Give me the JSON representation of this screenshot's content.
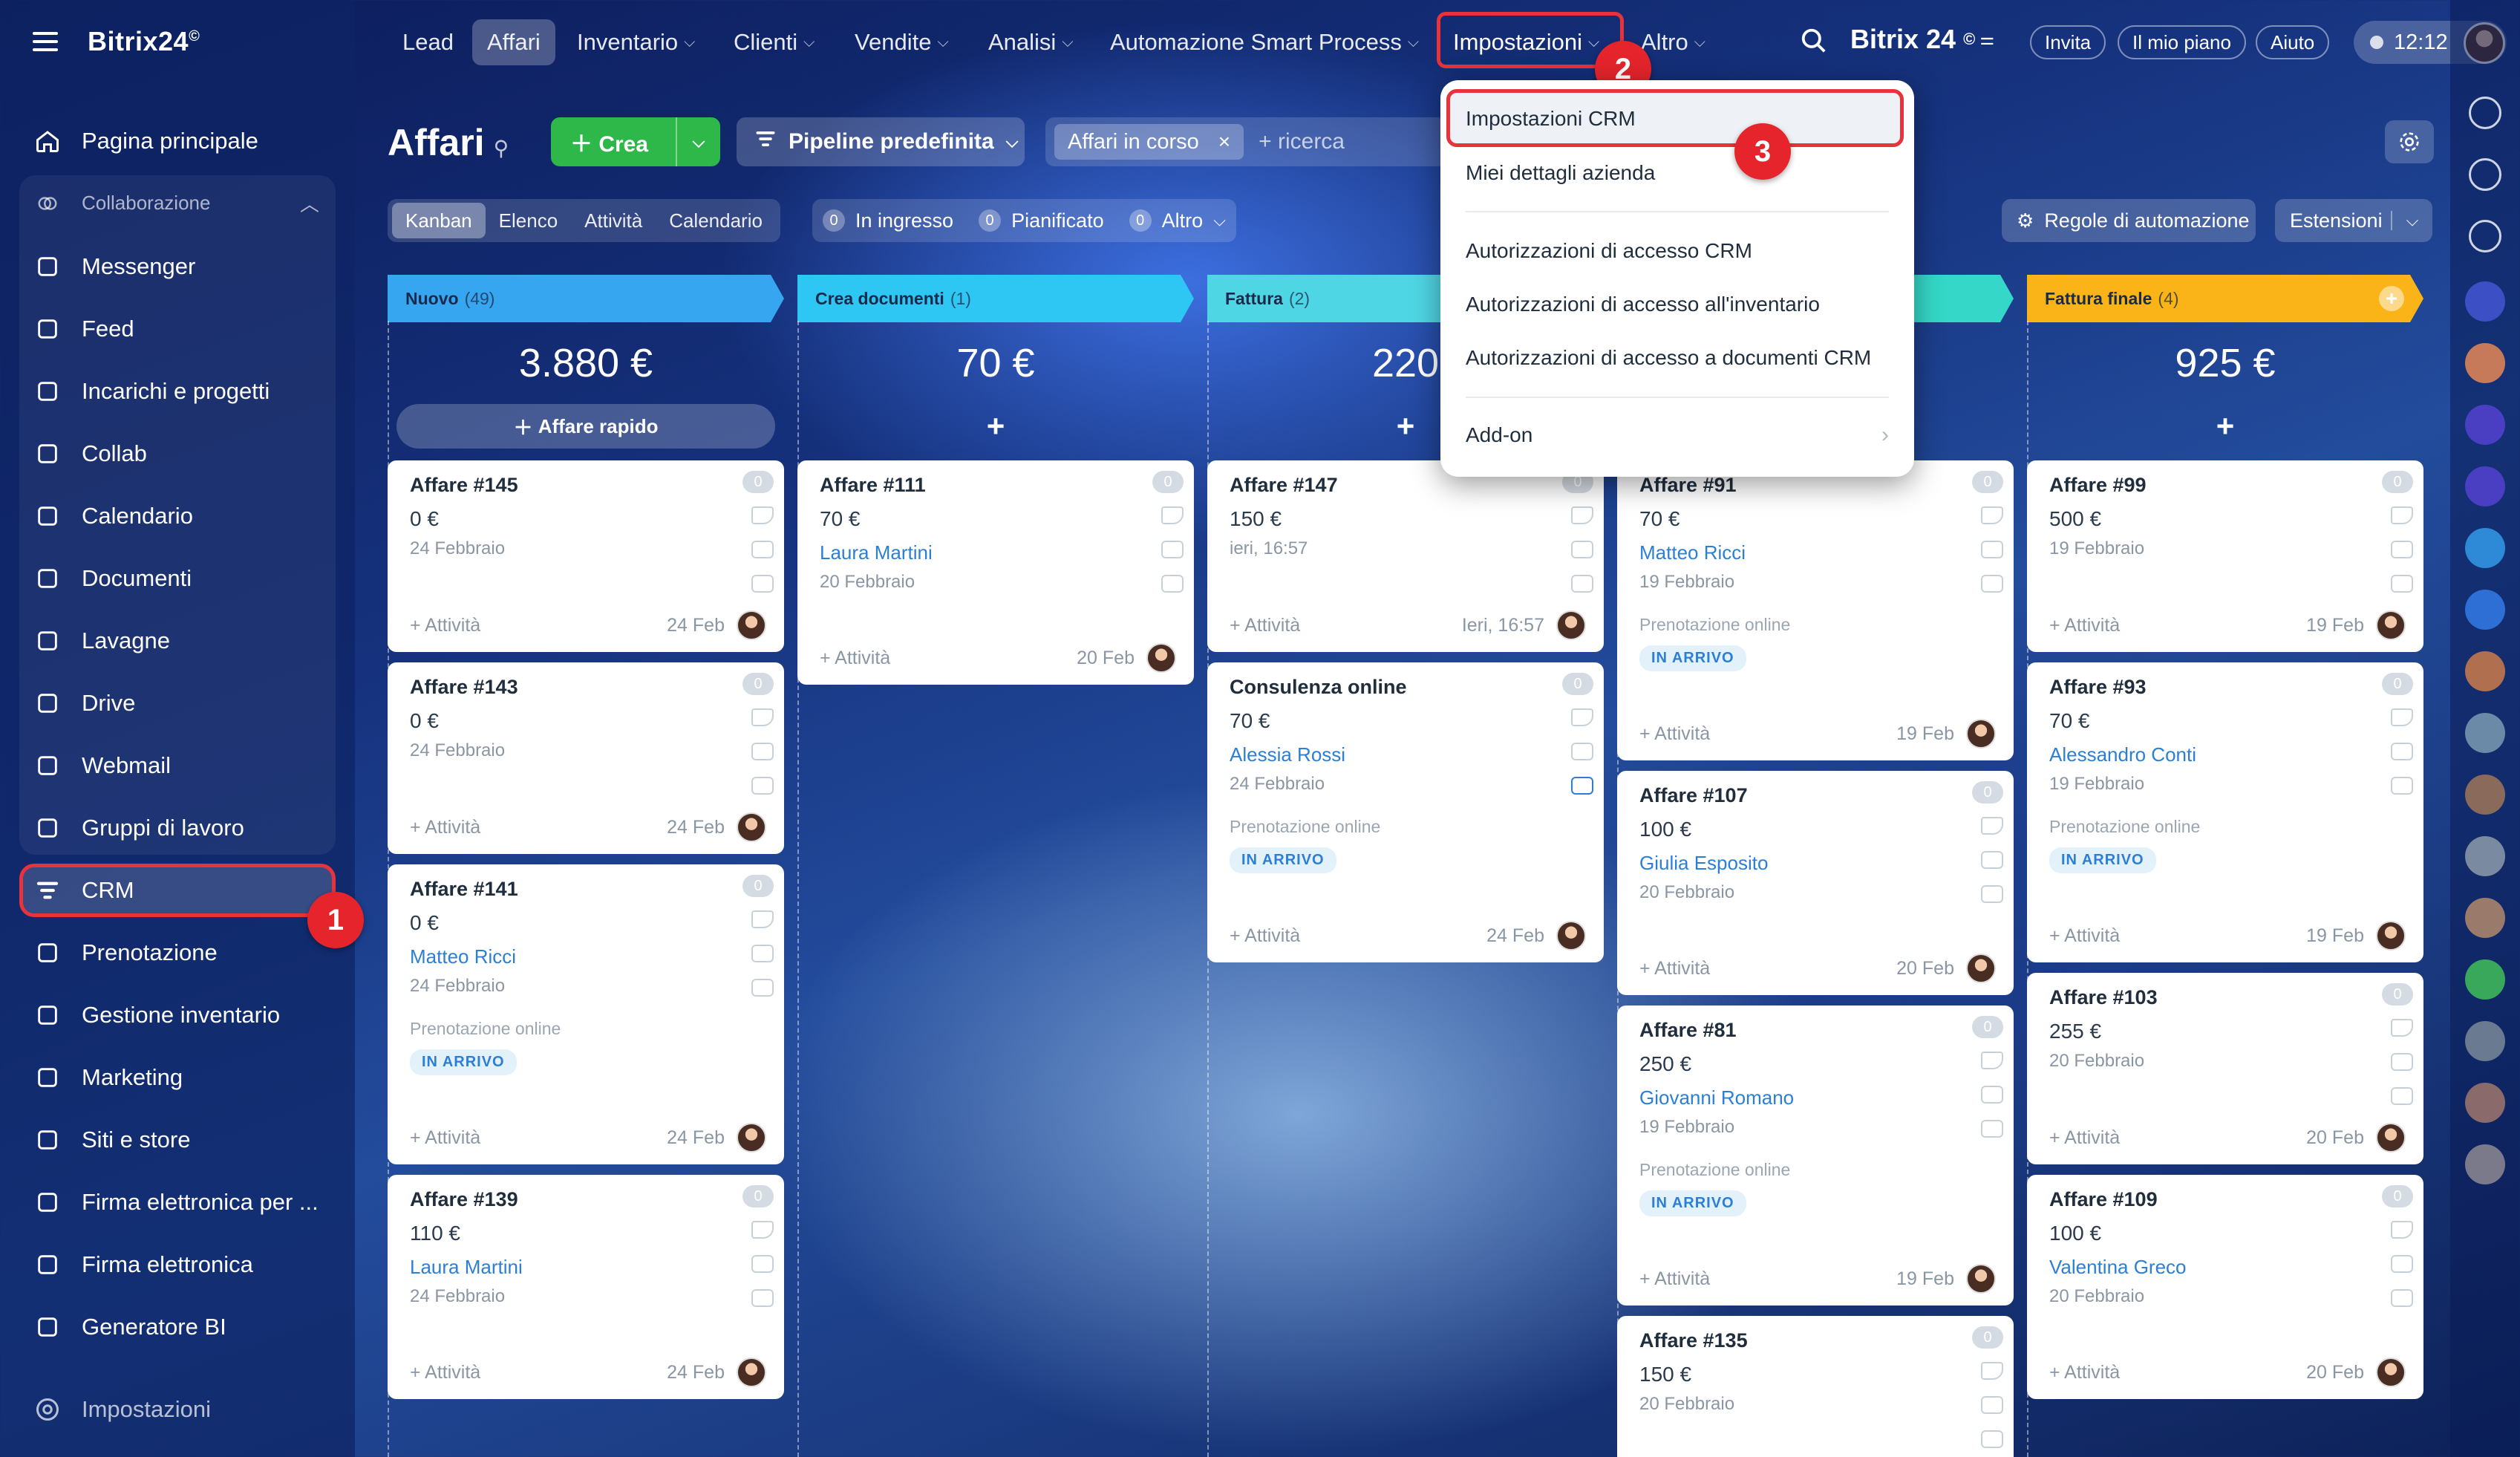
{
  "app": {
    "logo": "Bitrix24",
    "logo_mark": "©"
  },
  "sidebar": {
    "home": "Pagina principale",
    "group_label": "Collaborazione",
    "items": [
      {
        "label": "Messenger",
        "icon": "messenger-icon"
      },
      {
        "label": "Feed",
        "icon": "feed-icon"
      },
      {
        "label": "Incarichi e progetti",
        "icon": "tasks-icon"
      },
      {
        "label": "Collab",
        "icon": "collab-icon"
      },
      {
        "label": "Calendario",
        "icon": "calendar-icon"
      },
      {
        "label": "Documenti",
        "icon": "documents-icon"
      },
      {
        "label": "Lavagne",
        "icon": "boards-icon"
      },
      {
        "label": "Drive",
        "icon": "drive-icon"
      },
      {
        "label": "Webmail",
        "icon": "mail-icon"
      },
      {
        "label": "Gruppi di lavoro",
        "icon": "groups-icon"
      }
    ],
    "crm": "CRM",
    "items2": [
      {
        "label": "Prenotazione",
        "icon": "booking-icon"
      },
      {
        "label": "Gestione inventario",
        "icon": "inventory-icon"
      },
      {
        "label": "Marketing",
        "icon": "marketing-icon"
      },
      {
        "label": "Siti e store",
        "icon": "store-icon"
      },
      {
        "label": "Firma elettronica per ...",
        "icon": "esign-hr-icon"
      },
      {
        "label": "Firma elettronica",
        "icon": "esign-icon"
      },
      {
        "label": "Generatore BI",
        "icon": "bi-icon"
      }
    ],
    "settings": "Impostazioni"
  },
  "topnav": {
    "items": [
      "Lead",
      "Affari",
      "Inventario",
      "Clienti",
      "Vendite",
      "Analisi",
      "Automazione Smart Process",
      "Impostazioni",
      "Altro"
    ],
    "brand": "Bitrix 24",
    "invite": "Invita",
    "plan": "Il mio piano",
    "help": "Aiuto",
    "clock": "12:12"
  },
  "toolbar": {
    "title": "Affari",
    "create": "Crea",
    "pipeline": "Pipeline predefinita",
    "filter_chip": "Affari in corso",
    "search_placeholder": "+ ricerca",
    "views": [
      "Kanban",
      "Elenco",
      "Attività",
      "Calendario"
    ],
    "counters": [
      {
        "n": "0",
        "label": "In ingresso"
      },
      {
        "n": "0",
        "label": "Pianificato"
      },
      {
        "n": "0",
        "label": "Altro"
      }
    ],
    "rules": "Regole di automazione",
    "extensions": "Estensioni"
  },
  "kanban": {
    "quick_deal": "Affare rapido",
    "add_activity": "+ Attività",
    "columns": [
      {
        "name": "Nuovo",
        "count": "(49)",
        "total": "3.880 €",
        "color": "#37a6f0"
      },
      {
        "name": "Crea documenti",
        "count": "(1)",
        "total": "70 €",
        "color": "#2ec6f2"
      },
      {
        "name": "Fattura",
        "count": "(2)",
        "total": "220",
        "color": "#4fd6e4"
      },
      {
        "name": "",
        "count": "",
        "total": "",
        "color": "#35d8c8"
      },
      {
        "name": "Fattura finale",
        "count": "(4)",
        "total": "925 €",
        "color": "#fbb417"
      }
    ],
    "cards": [
      {
        "col": 0,
        "title": "Affare #145",
        "amount": "0 €",
        "contact": "",
        "date": "24 Febbraio",
        "source": "",
        "tag": "",
        "foot": "24 Feb",
        "badge": "0"
      },
      {
        "col": 0,
        "title": "Affare #143",
        "amount": "0 €",
        "contact": "",
        "date": "24 Febbraio",
        "source": "",
        "tag": "",
        "foot": "24 Feb",
        "badge": "0"
      },
      {
        "col": 0,
        "title": "Affare #141",
        "amount": "0 €",
        "contact": "Matteo Ricci",
        "date": "24 Febbraio",
        "source": "Prenotazione online",
        "tag": "IN ARRIVO",
        "foot": "24 Feb",
        "badge": "0"
      },
      {
        "col": 0,
        "title": "Affare #139",
        "amount": "110 €",
        "contact": "Laura Martini",
        "date": "24 Febbraio",
        "source": "",
        "tag": "",
        "foot": "24 Feb",
        "badge": "0"
      },
      {
        "col": 1,
        "title": "Affare #111",
        "amount": "70 €",
        "contact": "Laura Martini",
        "date": "20 Febbraio",
        "source": "",
        "tag": "",
        "foot": "20 Feb",
        "badge": "0"
      },
      {
        "col": 2,
        "title": "Affare #147",
        "amount": "150 €",
        "contact": "",
        "date": "ieri, 16:57",
        "source": "",
        "tag": "",
        "foot": "Ieri, 16:57",
        "badge": "0"
      },
      {
        "col": 2,
        "title": "Consulenza online",
        "amount": "70 €",
        "contact": "Alessia Rossi",
        "date": "24 Febbraio",
        "source": "Prenotazione online",
        "tag": "IN ARRIVO",
        "foot": "24 Feb",
        "badge": "0"
      },
      {
        "col": 3,
        "title": "Affare #91",
        "amount": "70 €",
        "contact": "Matteo Ricci",
        "date": "19 Febbraio",
        "source": "Prenotazione online",
        "tag": "IN ARRIVO",
        "foot": "19 Feb",
        "badge": "0"
      },
      {
        "col": 3,
        "title": "Affare #107",
        "amount": "100 €",
        "contact": "Giulia Esposito",
        "date": "20 Febbraio",
        "source": "",
        "tag": "",
        "foot": "20 Feb",
        "badge": "0"
      },
      {
        "col": 3,
        "title": "Affare #81",
        "amount": "250 €",
        "contact": "Giovanni Romano",
        "date": "19 Febbraio",
        "source": "Prenotazione online",
        "tag": "IN ARRIVO",
        "foot": "19 Feb",
        "badge": "0"
      },
      {
        "col": 3,
        "title": "Affare #135",
        "amount": "150 €",
        "contact": "",
        "date": "20 Febbraio",
        "source": "",
        "tag": "",
        "foot": "",
        "badge": "0"
      },
      {
        "col": 4,
        "title": "Affare #99",
        "amount": "500 €",
        "contact": "",
        "date": "19 Febbraio",
        "source": "",
        "tag": "",
        "foot": "19 Feb",
        "badge": "0"
      },
      {
        "col": 4,
        "title": "Affare #93",
        "amount": "70 €",
        "contact": "Alessandro Conti",
        "date": "19 Febbraio",
        "source": "Prenotazione online",
        "tag": "IN ARRIVO",
        "foot": "19 Feb",
        "badge": "0"
      },
      {
        "col": 4,
        "title": "Affare #103",
        "amount": "255 €",
        "contact": "",
        "date": "20 Febbraio",
        "source": "",
        "tag": "",
        "foot": "20 Feb",
        "badge": "0"
      },
      {
        "col": 4,
        "title": "Affare #109",
        "amount": "100 €",
        "contact": "Valentina Greco",
        "date": "20 Febbraio",
        "source": "",
        "tag": "",
        "foot": "20 Feb",
        "badge": "0"
      }
    ]
  },
  "menu": {
    "items": [
      "Impostazioni CRM",
      "Miei dettagli azienda",
      "Autorizzazioni di accesso CRM",
      "Autorizzazioni di accesso all'inventario",
      "Autorizzazioni di accesso a documenti CRM",
      "Add-on"
    ]
  },
  "steps": [
    "1",
    "2",
    "3"
  ],
  "colors": {
    "highlight": "#e8323c",
    "create": "#2fb84a",
    "link": "#2b7fd6"
  }
}
